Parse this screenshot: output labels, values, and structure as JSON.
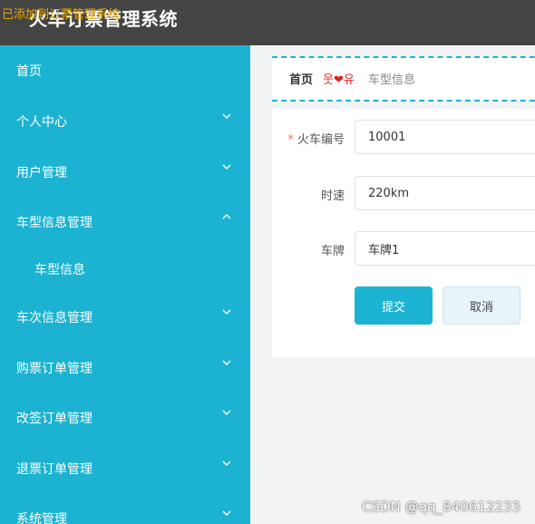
{
  "header": {
    "title": "火车订票管理系统",
    "overlay_notice": "已添加到订票管理系统"
  },
  "sidebar": {
    "items": [
      {
        "label": "首页",
        "chevron": "none"
      },
      {
        "label": "个人中心",
        "chevron": "down"
      },
      {
        "label": "用户管理",
        "chevron": "down"
      },
      {
        "label": "车型信息管理",
        "chevron": "up"
      },
      {
        "label": "车型信息",
        "chevron": "none",
        "sub": true
      },
      {
        "label": "车次信息管理",
        "chevron": "down"
      },
      {
        "label": "购票订单管理",
        "chevron": "down"
      },
      {
        "label": "改签订单管理",
        "chevron": "down"
      },
      {
        "label": "退票订单管理",
        "chevron": "down"
      },
      {
        "label": "系统管理",
        "chevron": "down"
      }
    ]
  },
  "breadcrumb": {
    "home": "首页",
    "separator": "웃❤유",
    "current": "车型信息"
  },
  "form": {
    "fields": [
      {
        "label": "火车编号",
        "value": "10001",
        "required": true
      },
      {
        "label": "时速",
        "value": "220km",
        "required": false
      },
      {
        "label": "车牌",
        "value": "车牌1",
        "required": false
      }
    ],
    "required_mark": "*",
    "submit_label": "提交",
    "cancel_label": "取消"
  },
  "watermark": "CSDN @qq_840612233",
  "colors": {
    "accent": "#1bb3d1",
    "header_bg": "#444444",
    "overlay_text": "#e8a800"
  }
}
